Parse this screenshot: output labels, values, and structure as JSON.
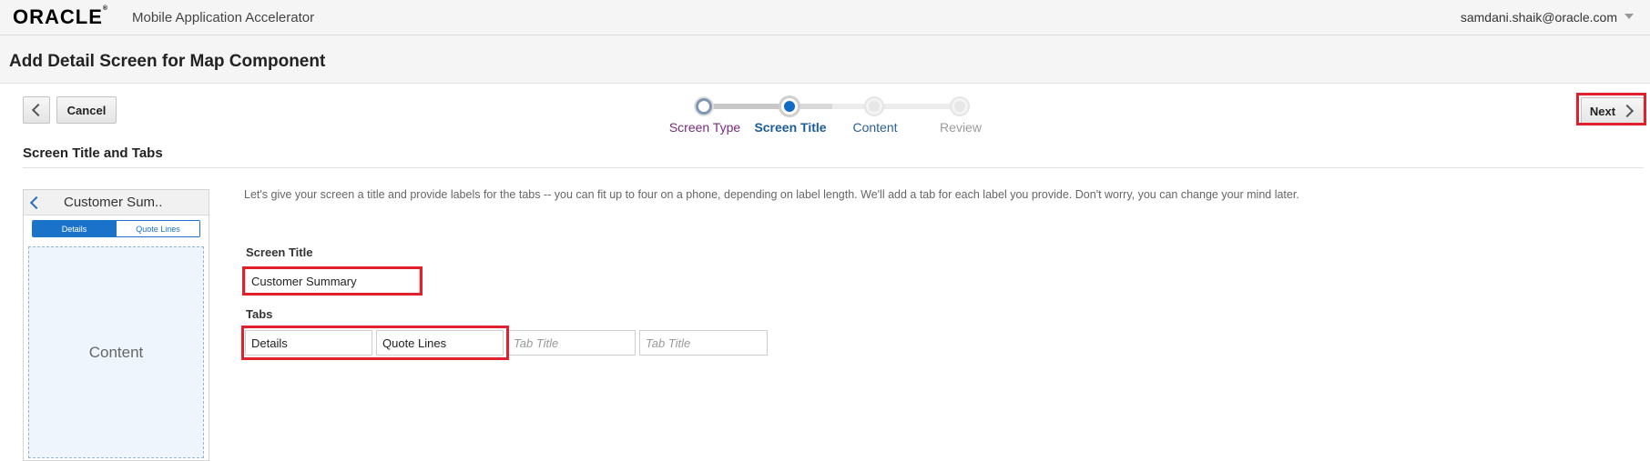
{
  "header": {
    "logo": "ORACLE",
    "logo_mark": "®",
    "app_name": "Mobile Application Accelerator",
    "user": "samdani.shaik@oracle.com"
  },
  "page": {
    "title": "Add Detail Screen for Map Component"
  },
  "toolbar": {
    "cancel_label": "Cancel",
    "next_label": "Next"
  },
  "train": {
    "steps": [
      {
        "label": "Screen Type",
        "state": "visited"
      },
      {
        "label": "Screen Title",
        "state": "current"
      },
      {
        "label": "Content",
        "state": "future"
      },
      {
        "label": "Review",
        "state": "disabled"
      }
    ]
  },
  "section": {
    "heading": "Screen Title and Tabs",
    "intro": "Let's give your screen a title and provide labels for the tabs -- you can fit up to four on a phone, depending on label length. We'll add a tab for each label you provide. Don't worry, you can change your mind later."
  },
  "preview": {
    "title": "Customer Sum..",
    "tabs": [
      "Details",
      "Quote Lines"
    ],
    "content_label": "Content"
  },
  "form": {
    "screen_title_label": "Screen Title",
    "screen_title_value": "Customer Summary",
    "tabs_label": "Tabs",
    "tabs": [
      {
        "value": "Details",
        "placeholder": "Tab Title"
      },
      {
        "value": "Quote Lines",
        "placeholder": "Tab Title"
      },
      {
        "value": "",
        "placeholder": "Tab Title"
      },
      {
        "value": "",
        "placeholder": "Tab Title"
      }
    ]
  },
  "colors": {
    "highlight": "#e0202c",
    "accent": "#0f6cc7"
  }
}
